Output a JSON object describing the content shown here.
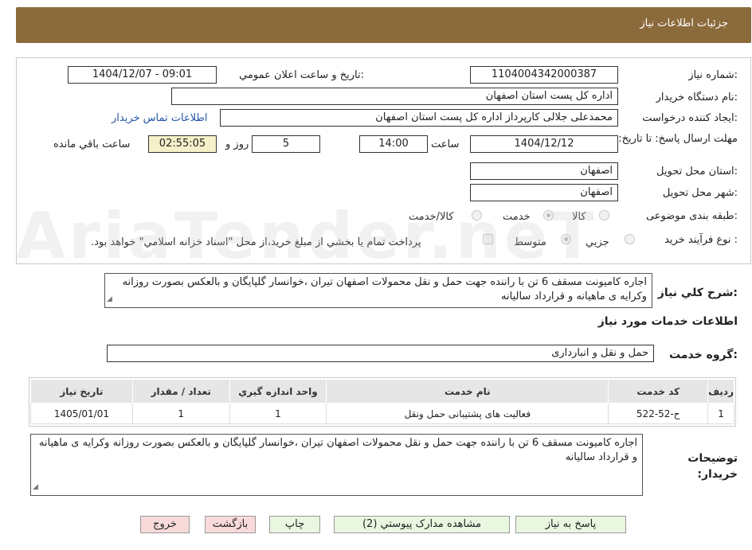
{
  "header": {
    "title": "جزئیات اطلاعات نیاز"
  },
  "form": {
    "need_number_label": "شماره نیاز:",
    "need_number": "1104004342000387",
    "announce_label": "تاریخ و ساعت اعلان عمومي:",
    "announce_value": "1404/12/07 - 09:01",
    "buyer_org_label": "نام دستگاه خريدار:",
    "buyer_org": "اداره کل پست استان اصفهان",
    "requester_label": "ايجاد کننده درخواست:",
    "requester": "محمدعلی جلالی کارپرداز اداره کل پست استان اصفهان",
    "contact_link": "اطلاعات تماس خريدار",
    "deadline_label": "مهلت ارسال پاسخ: تا تاریخ:",
    "deadline_date": "1404/12/12",
    "time_label": "ساعت",
    "deadline_time": "14:00",
    "days_value": "5",
    "days_label": "روز و",
    "remaining_time": "02:55:05",
    "remaining_label": "ساعت باقي مانده",
    "province_label": "استان محل تحويل:",
    "province": "اصفهان",
    "city_label": "شهر محل تحويل:",
    "city": "اصفهان",
    "category_label": "طبقه بندی موضوعی:",
    "category_options": [
      "کالا",
      "خدمت",
      "کالا/خدمت"
    ],
    "category_selected": "خدمت",
    "process_label": "نوع فرآيند خريد :",
    "process_options": [
      "جزيي",
      "متوسط"
    ],
    "process_selected": "متوسط",
    "payment_note": "پرداخت تمام يا بخشي از مبلغ خريد،از محل \"اسناد خزانه اسلامي\" خواهد بود."
  },
  "description": {
    "label": "شرح کلي نياز:",
    "text": "اجاره کامیونت مسقف 6 تن با راننده  جهت حمل و نقل محمولات  اصفهان تیران ،خوانسار گلپایگان و بالعکس بصورت روزانه وکرایه ی ماهیانه و قرارداد سالیانه"
  },
  "services": {
    "section_title": "اطلاعات خدمات مورد نياز",
    "group_label": "گروه خدمت:",
    "group_value": "حمل و نقل و انبارداری",
    "columns": [
      "رديف",
      "کد خدمت",
      "نام خدمت",
      "واحد اندازه گيري",
      "تعداد / مقدار",
      "تاريخ نياز"
    ],
    "rows": [
      [
        "1",
        "ح-52-522",
        "فعالیت های پشتیبانی حمل ونقل",
        "1",
        "1",
        "1405/01/01"
      ]
    ]
  },
  "buyer_notes": {
    "label": "توضيحات خريدار:",
    "text": "اجاره کامیونت مسقف 6 تن با راننده  جهت حمل و نقل محمولات  اصفهان تیران ،خوانسار گلپایگان و بالعکس بصورت روزانه وکرایه ی ماهیانه و قرارداد سالیانه"
  },
  "buttons": {
    "reply": "پاسخ به نياز",
    "attachments": "مشاهده مدارک پيوستي (2)",
    "print": "چاپ",
    "back": "بازگشت",
    "exit": "خروج"
  }
}
